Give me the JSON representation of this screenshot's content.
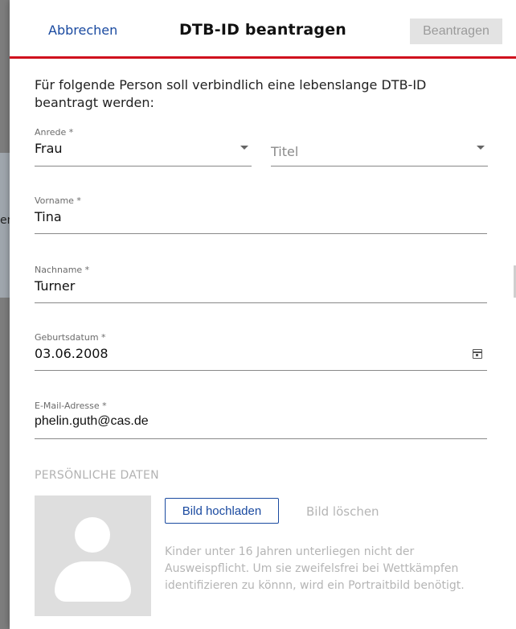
{
  "backdrop": {
    "peek_text": "en"
  },
  "header": {
    "cancel_label": "Abbrechen",
    "title": "DTB-ID beantragen",
    "submit_label": "Beantragen"
  },
  "intro": "Für folgende Person soll verbindlich eine lebenslange DTB-ID beantragt werden:",
  "form": {
    "salutation": {
      "label": "Anrede *",
      "value": "Frau"
    },
    "title": {
      "placeholder": "Titel"
    },
    "first_name": {
      "label": "Vorname *",
      "value": "Tina"
    },
    "last_name": {
      "label": "Nachname *",
      "value": "Turner"
    },
    "birthdate": {
      "label": "Geburtsdatum *",
      "value": "03.06.2008"
    },
    "email": {
      "label": "E-Mail-Adresse *",
      "value": "phelin.guth@cas.de"
    }
  },
  "personal": {
    "section_title": "PERSÖNLICHE DATEN",
    "upload_label": "Bild hochladen",
    "delete_label": "Bild löschen",
    "note": "Kinder unter 16 Jahren unterliegen nicht der Ausweispflicht. Um sie zweifelsfrei bei Wettkämpfen identifizieren zu könnn, wird ein Portraitbild benötigt."
  },
  "colors": {
    "accent": "#d0101d",
    "link": "#1a4aa0"
  },
  "icons": [
    "chevron-down-icon",
    "calendar-icon",
    "person-placeholder-icon"
  ]
}
